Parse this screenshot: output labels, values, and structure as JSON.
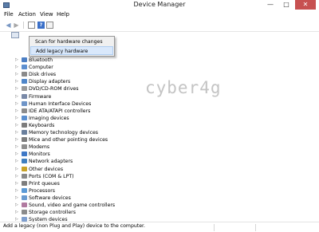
{
  "window": {
    "title": "Device Manager",
    "minimize": "—",
    "maximize": "□",
    "close": "✕"
  },
  "menu": [
    "File",
    "Action",
    "View",
    "Help"
  ],
  "toolbar": {
    "back_icon": "◀",
    "forward_icon": "▶",
    "help_icon": "?"
  },
  "context_menu": {
    "items": [
      "Scan for hardware changes",
      "Add legacy hardware"
    ],
    "highlighted": "Add legacy hardware"
  },
  "tree": {
    "expander": "▷",
    "categories": [
      {
        "label": "Bluetooth",
        "icon": "bluetooth-icon"
      },
      {
        "label": "Computer",
        "icon": "computer-icon"
      },
      {
        "label": "Disk drives",
        "icon": "disk-drive-icon"
      },
      {
        "label": "Display adapters",
        "icon": "display-adapter-icon"
      },
      {
        "label": "DVD/CD-ROM drives",
        "icon": "dvd-drive-icon"
      },
      {
        "label": "Firmware",
        "icon": "firmware-icon"
      },
      {
        "label": "Human Interface Devices",
        "icon": "hid-icon"
      },
      {
        "label": "IDE ATA/ATAPI controllers",
        "icon": "ide-controller-icon"
      },
      {
        "label": "Imaging devices",
        "icon": "imaging-device-icon"
      },
      {
        "label": "Keyboards",
        "icon": "keyboard-icon"
      },
      {
        "label": "Memory technology devices",
        "icon": "memory-device-icon"
      },
      {
        "label": "Mice and other pointing devices",
        "icon": "mouse-icon"
      },
      {
        "label": "Modems",
        "icon": "modem-icon"
      },
      {
        "label": "Monitors",
        "icon": "monitor-icon"
      },
      {
        "label": "Network adapters",
        "icon": "network-adapter-icon"
      },
      {
        "label": "Other devices",
        "icon": "other-device-icon"
      },
      {
        "label": "Ports (COM & LPT)",
        "icon": "port-icon"
      },
      {
        "label": "Print queues",
        "icon": "printer-icon"
      },
      {
        "label": "Processors",
        "icon": "processor-icon"
      },
      {
        "label": "Software devices",
        "icon": "software-device-icon"
      },
      {
        "label": "Sound, video and game controllers",
        "icon": "sound-controller-icon"
      },
      {
        "label": "Storage controllers",
        "icon": "storage-controller-icon"
      },
      {
        "label": "System devices",
        "icon": "system-device-icon"
      }
    ]
  },
  "watermark": "cyber4g",
  "status": {
    "text": "Add a legacy (non Plug and Play) device to the computer."
  },
  "colors": {
    "close_button": "#c75050",
    "highlight": "#d9e8fb",
    "icon_blue": "#5a7da8"
  }
}
